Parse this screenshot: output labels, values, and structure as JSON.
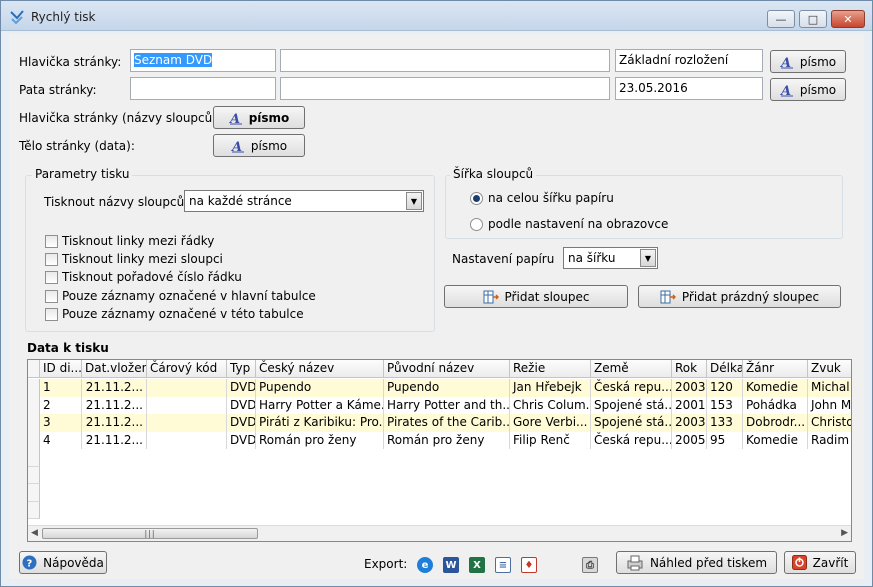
{
  "window": {
    "title": "Rychlý tisk"
  },
  "header": {
    "page_header_label": "Hlavička stránky:",
    "page_header_value": "Seznam DVD",
    "page_header_value2": "",
    "layout_value": "Základní rozložení",
    "page_footer_label": "Pata stránky:",
    "page_footer_value": "",
    "page_footer_value2": "",
    "date_value": "23.05.2016",
    "font_button": "písmo",
    "column_header_label": "Hlavička stránky (názvy sloupců):",
    "column_header_font_button": "písmo",
    "body_label": "Tělo stránky (data):",
    "body_font_button": "písmo"
  },
  "print_params": {
    "title": "Parametry tisku",
    "print_column_names_label": "Tisknout názvy sloupců",
    "print_column_names_value": "na každé stránce",
    "checkboxes": [
      {
        "label": "Tisknout linky mezi řádky",
        "checked": false
      },
      {
        "label": "Tisknout linky mezi sloupci",
        "checked": false
      },
      {
        "label": "Tisknout pořadové číslo řádku",
        "checked": false
      },
      {
        "label": "Pouze záznamy označené v hlavní tabulce",
        "checked": false
      },
      {
        "label": "Pouze záznamy označené v této tabulce",
        "checked": false
      }
    ]
  },
  "column_width": {
    "title": "Šířka sloupců",
    "options": [
      {
        "label": "na celou šířku papíru",
        "selected": true
      },
      {
        "label": "podle nastavení na obrazovce",
        "selected": false
      }
    ],
    "paper_label": "Nastavení papíru",
    "paper_value": "na šířku",
    "add_column_button": "Přidat sloupec",
    "add_empty_column_button": "Přidat prázdný sloupec"
  },
  "data_section": {
    "title": "Data k tisku",
    "columns": [
      "ID di...",
      "Dat.vložení",
      "Čárový kód",
      "Typ",
      "Český název",
      "Původní název",
      "Režie",
      "Země",
      "Rok",
      "Délka",
      "Žánr",
      "Zvuk"
    ],
    "rows": [
      [
        "1",
        "21.11.2...",
        "",
        "DVD",
        "Pupendo",
        "Pupendo",
        "Jan  Hřebejk",
        "Česká repu...",
        "2003",
        "120",
        "Komedie",
        "Michal"
      ],
      [
        "2",
        "21.11.2...",
        "",
        "DVD",
        "Harry Potter a Káme...",
        "Harry Potter and th...",
        "Chris Colum...",
        "Spojené stá...",
        "2001",
        "153",
        "Pohádka",
        "John M"
      ],
      [
        "3",
        "21.11.2...",
        "",
        "DVD",
        "Piráti z Karibiku: Pro...",
        "Pirates of the Carib...",
        "Gore Verbi...",
        "Spojené stá...",
        "2003",
        "133",
        "Dobrodr...",
        "Christop"
      ],
      [
        "4",
        "21.11.2...",
        "",
        "DVD",
        "Román pro ženy",
        "Román pro ženy",
        "Filip Renč",
        "Česká repu...",
        "2005",
        "95",
        "Komedie",
        "Radim H"
      ]
    ]
  },
  "footer": {
    "help_button": "Nápověda",
    "export_label": "Export:",
    "preview_button": "Náhled před tiskem",
    "close_button": "Zavřít"
  }
}
